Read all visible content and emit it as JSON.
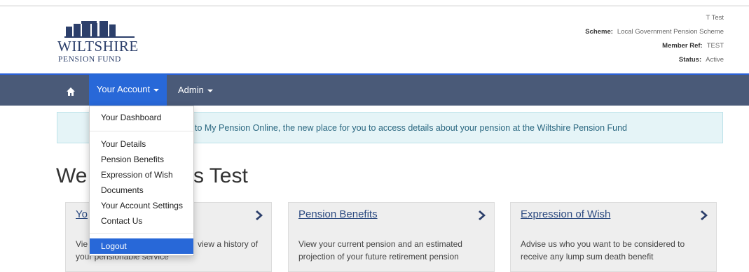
{
  "logo": {
    "line1": "WILTSHIRE",
    "line2": "PENSION FUND",
    "color": "#2c3f6b"
  },
  "member": {
    "name": "T Test",
    "scheme_label": "Scheme:",
    "scheme_value": "Local Government Pension Scheme",
    "ref_label": "Member Ref:",
    "ref_value": "TEST",
    "status_label": "Status:",
    "status_value": "Active"
  },
  "nav": {
    "home_icon": "home-icon",
    "account_label": "Your Account",
    "admin_label": "Admin",
    "bg": "#4a5a78",
    "active_bg": "#2868d8"
  },
  "alert": {
    "text": "to My Pension Online, the new place for you to access details about your pension at the Wiltshire Pension Fund"
  },
  "welcome": {
    "start": "We",
    "end": "s Test"
  },
  "dropdown": {
    "items": [
      {
        "label": "Your Dashboard"
      },
      {
        "label": "Your Details"
      },
      {
        "label": "Pension Benefits"
      },
      {
        "label": "Expression of Wish"
      },
      {
        "label": "Documents"
      },
      {
        "label": "Your Account Settings"
      },
      {
        "label": "Contact Us"
      },
      {
        "label": "Logout"
      }
    ]
  },
  "cards": [
    {
      "title": "Yo",
      "desc_line1": "Vie",
      "desc_line1_end": "view a history of",
      "desc_line2": "your pensionable service"
    },
    {
      "title": "Pension Benefits",
      "desc": "View your current pension and an estimated projection of your future retirement pension"
    },
    {
      "title": "Expression of Wish",
      "desc": "Advise us who you want to be considered to receive any lump sum death benefit"
    }
  ]
}
